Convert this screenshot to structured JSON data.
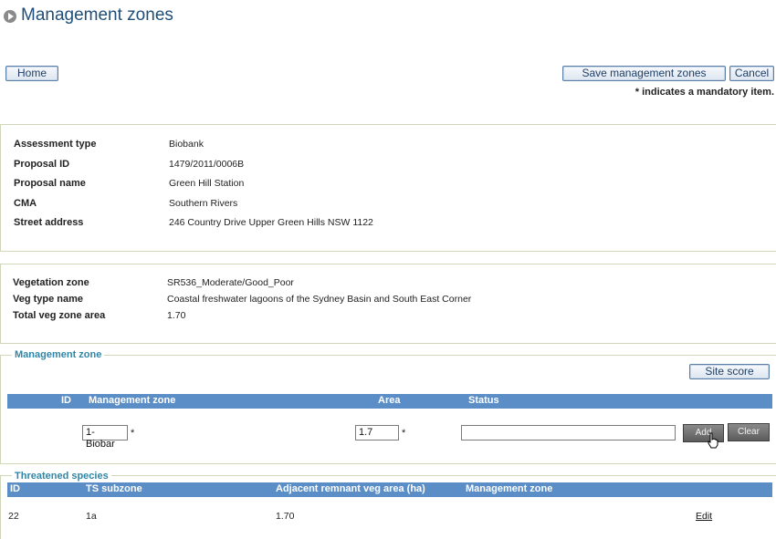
{
  "page": {
    "title": "Management zones"
  },
  "toolbar": {
    "home_label": "Home",
    "save_label": "Save management zones",
    "cancel_label": "Cancel",
    "mandatory_note": "* indicates a mandatory item."
  },
  "assessment": {
    "rows": [
      {
        "label": "Assessment type",
        "value": "Biobank"
      },
      {
        "label": "Proposal ID",
        "value": "1479/2011/0006B"
      },
      {
        "label": "Proposal name",
        "value": "Green Hill Station"
      },
      {
        "label": "CMA",
        "value": "Southern Rivers"
      },
      {
        "label": "Street address",
        "value": "246 Country Drive Upper Green Hills NSW 1122"
      }
    ]
  },
  "vegetation": {
    "rows": [
      {
        "label": "Vegetation zone",
        "value": "SR536_Moderate/Good_Poor"
      },
      {
        "label": "Veg type name",
        "value": "Coastal freshwater lagoons of the Sydney Basin and South East Corner"
      },
      {
        "label": "Total veg zone area",
        "value": "1.70"
      }
    ]
  },
  "management_zone": {
    "legend": "Management zone",
    "site_score_label": "Site score",
    "headers": {
      "id": "ID",
      "zone": "Management zone",
      "area": "Area",
      "status": "Status"
    },
    "zone_value": "1- Biobar",
    "area_value": "1.7",
    "status_value": "",
    "asterisk": "*",
    "add_label": "Add",
    "clear_label": "Clear"
  },
  "threatened_species": {
    "legend": "Threatened species",
    "headers": {
      "id": "ID",
      "subzone": "TS subzone",
      "adjacent": "Adjacent remnant veg area (ha)",
      "zone": "Management zone"
    },
    "rows": [
      {
        "id": "22",
        "subzone": "1a",
        "adjacent": "1.70",
        "zone": "",
        "action": "Edit"
      }
    ]
  }
}
